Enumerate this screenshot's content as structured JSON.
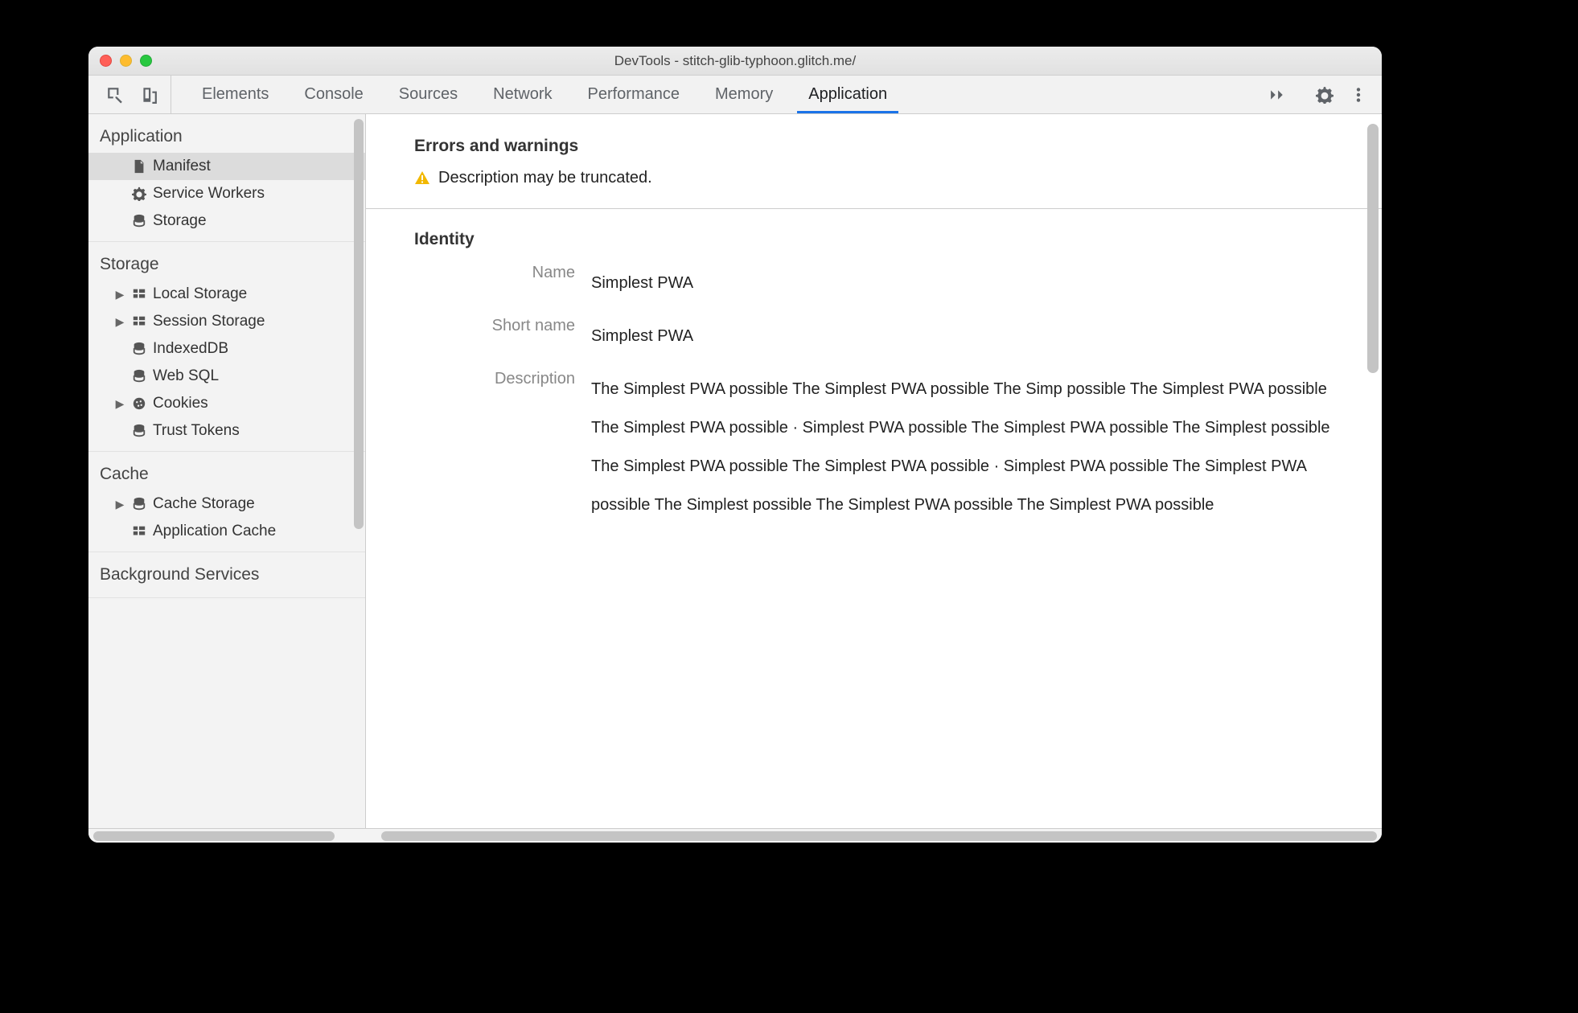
{
  "window": {
    "title": "DevTools - stitch-glib-typhoon.glitch.me/"
  },
  "toolbar": {
    "tabs": [
      "Elements",
      "Console",
      "Sources",
      "Network",
      "Performance",
      "Memory",
      "Application"
    ],
    "active_tab_index": 6
  },
  "sidebar": {
    "sections": [
      {
        "title": "Application",
        "items": [
          {
            "icon": "file-icon",
            "label": "Manifest",
            "selected": true,
            "expandable": false
          },
          {
            "icon": "gear-icon",
            "label": "Service Workers",
            "selected": false,
            "expandable": false
          },
          {
            "icon": "db-icon",
            "label": "Storage",
            "selected": false,
            "expandable": false
          }
        ]
      },
      {
        "title": "Storage",
        "items": [
          {
            "icon": "grid-icon",
            "label": "Local Storage",
            "expandable": true
          },
          {
            "icon": "grid-icon",
            "label": "Session Storage",
            "expandable": true
          },
          {
            "icon": "db-icon",
            "label": "IndexedDB",
            "expandable": false
          },
          {
            "icon": "db-icon",
            "label": "Web SQL",
            "expandable": false
          },
          {
            "icon": "cookie-icon",
            "label": "Cookies",
            "expandable": true
          },
          {
            "icon": "db-icon",
            "label": "Trust Tokens",
            "expandable": false
          }
        ]
      },
      {
        "title": "Cache",
        "items": [
          {
            "icon": "db-icon",
            "label": "Cache Storage",
            "expandable": true
          },
          {
            "icon": "grid-icon",
            "label": "Application Cache",
            "expandable": false
          }
        ]
      },
      {
        "title": "Background Services",
        "items": []
      }
    ]
  },
  "main": {
    "errors_heading": "Errors and warnings",
    "warning": "Description may be truncated.",
    "identity_heading": "Identity",
    "identity": {
      "name_label": "Name",
      "name_value": "Simplest PWA",
      "short_name_label": "Short name",
      "short_name_value": "Simplest PWA",
      "description_label": "Description",
      "description_value": "The Simplest PWA possible The Simplest PWA possible The Simp possible The Simplest PWA possible The Simplest PWA possible · Simplest PWA possible The Simplest PWA possible The Simplest possible The Simplest PWA possible The Simplest PWA possible · Simplest PWA possible The Simplest PWA possible The Simplest possible The Simplest PWA possible The Simplest PWA possible"
    }
  }
}
